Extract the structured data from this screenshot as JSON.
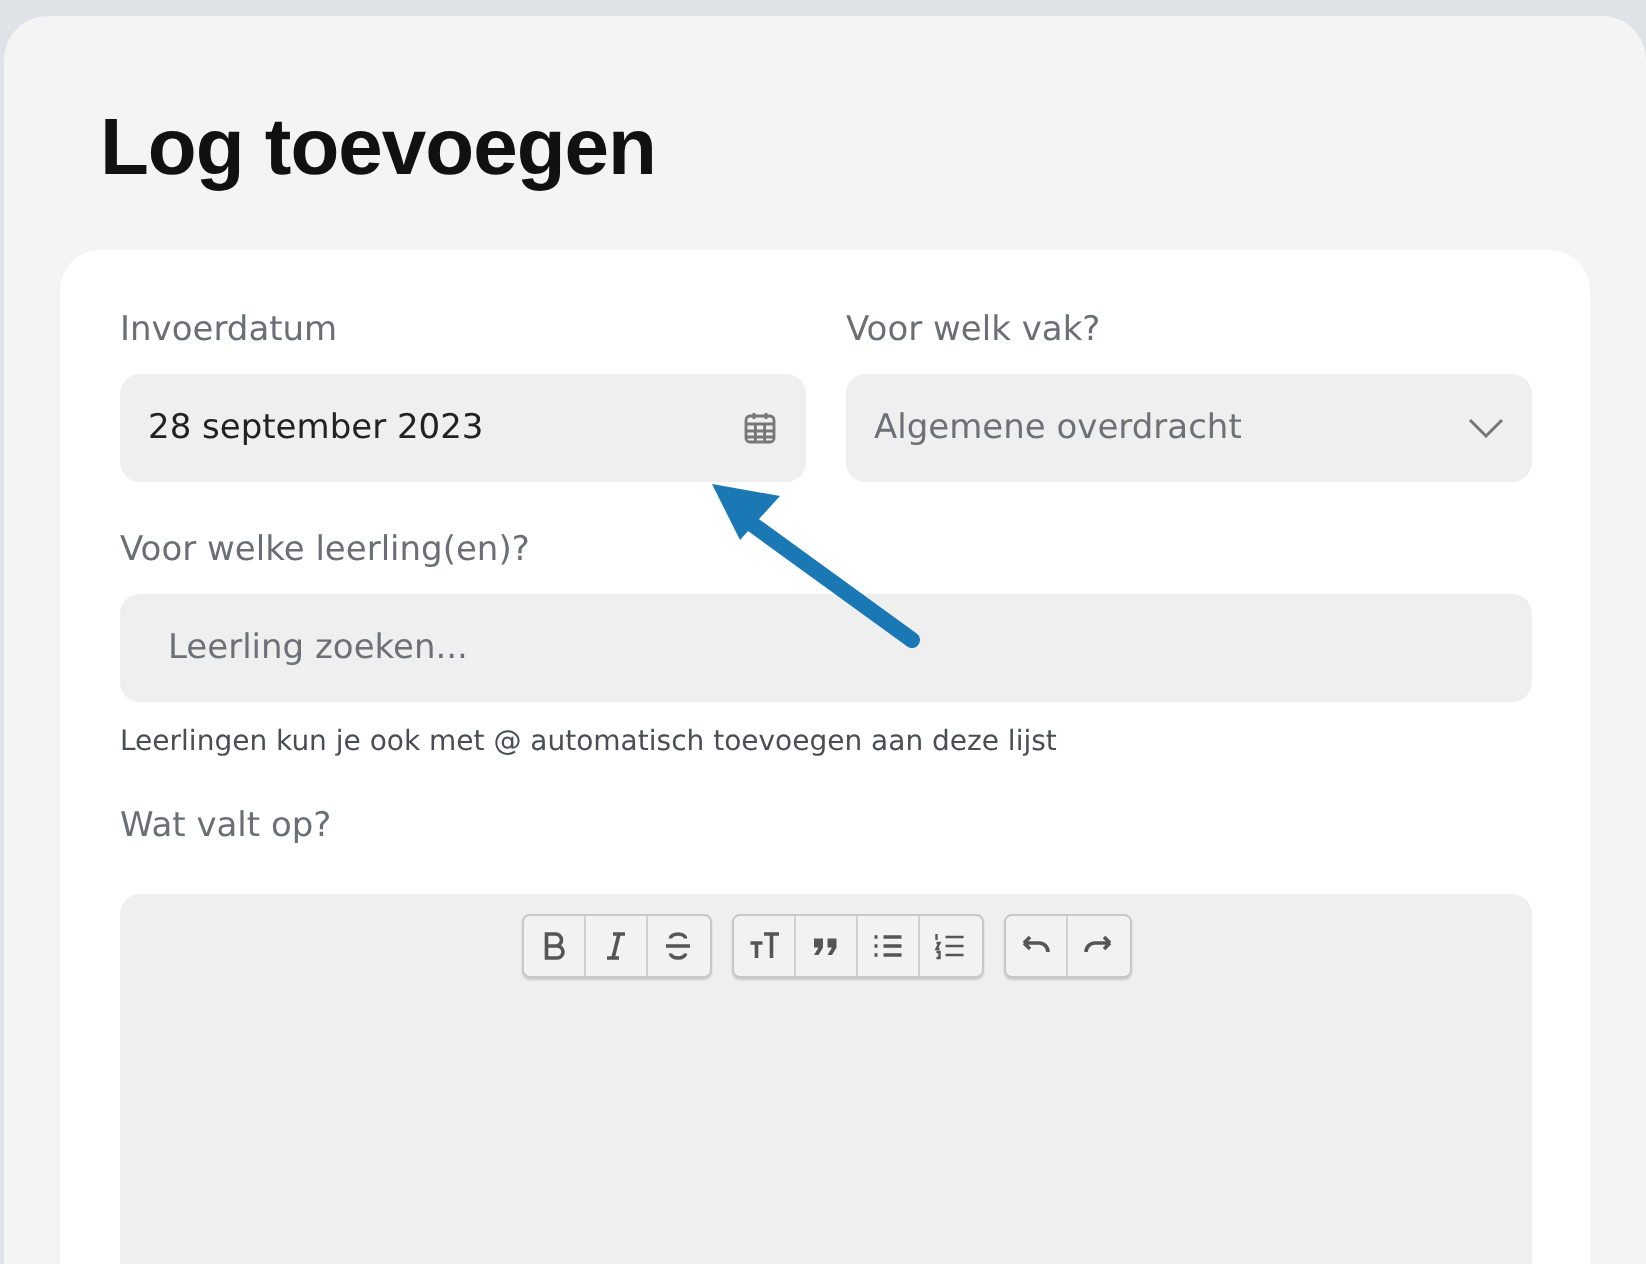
{
  "title": "Log toevoegen",
  "date_field": {
    "label": "Invoerdatum",
    "value": "28 september 2023"
  },
  "subject_field": {
    "label": "Voor welk vak?",
    "value": "Algemene overdracht"
  },
  "student_field": {
    "label": "Voor welke leerling(en)?",
    "placeholder": "Leerling zoeken...",
    "hint": "Leerlingen kun je ook met @ automatisch toevoegen aan deze lijst"
  },
  "notes_field": {
    "label": "Wat valt op?"
  }
}
